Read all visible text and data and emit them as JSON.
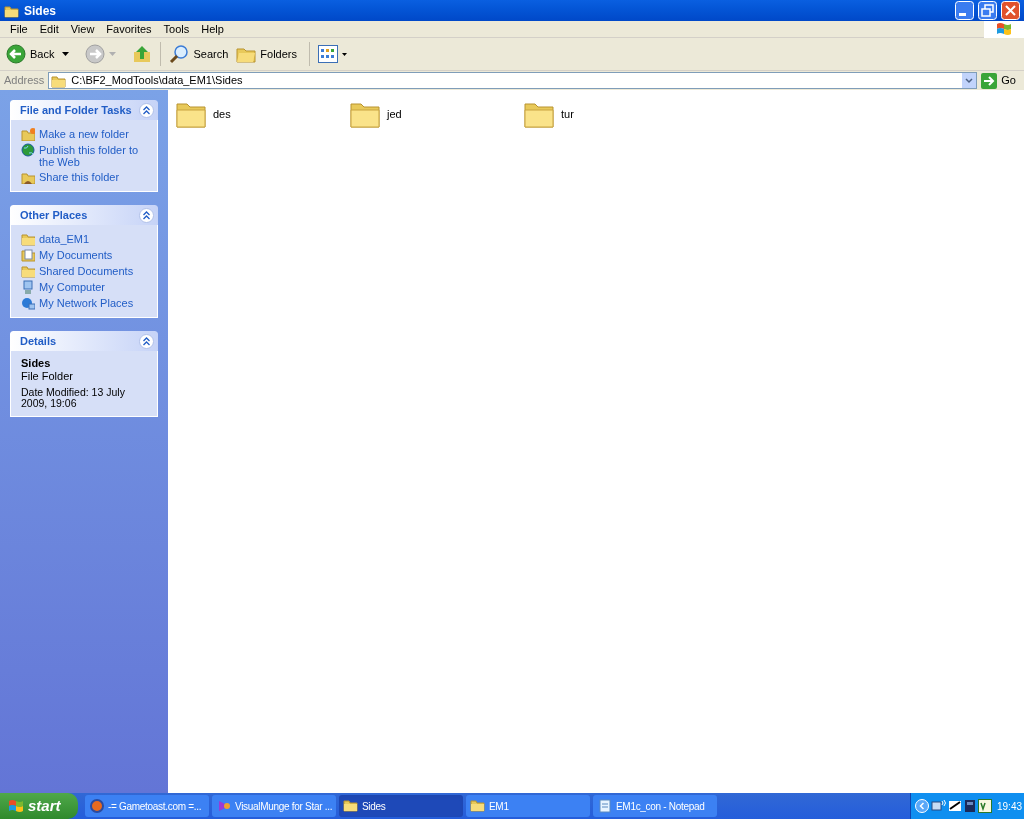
{
  "window": {
    "title": "Sides"
  },
  "menu": [
    "File",
    "Edit",
    "View",
    "Favorites",
    "Tools",
    "Help"
  ],
  "toolbar": {
    "back": "Back",
    "search": "Search",
    "folders": "Folders"
  },
  "address": {
    "label": "Address",
    "value": "C:\\BF2_ModTools\\data_EM1\\Sides",
    "go": "Go"
  },
  "sidebar": [
    {
      "title": "File and Folder Tasks",
      "items": [
        "Make a new folder",
        "Publish this folder to the Web",
        "Share this folder"
      ]
    },
    {
      "title": "Other Places",
      "items": [
        "data_EM1",
        "My Documents",
        "Shared Documents",
        "My Computer",
        "My Network Places"
      ]
    },
    {
      "title": "Details",
      "name": "Sides",
      "type": "File Folder",
      "modified": "Date Modified: 13 July 2009, 19:06"
    }
  ],
  "folders": [
    "des",
    "jed",
    "tur"
  ],
  "taskbar": {
    "start": "start",
    "tasks": [
      {
        "label": "-= Gametoast.com =...",
        "selected": false
      },
      {
        "label": "VisualMunge for Star ...",
        "selected": false
      },
      {
        "label": "Sides",
        "selected": true
      },
      {
        "label": "EM1",
        "selected": false
      },
      {
        "label": "EM1c_con - Notepad",
        "selected": false
      }
    ],
    "clock": "19:43"
  }
}
